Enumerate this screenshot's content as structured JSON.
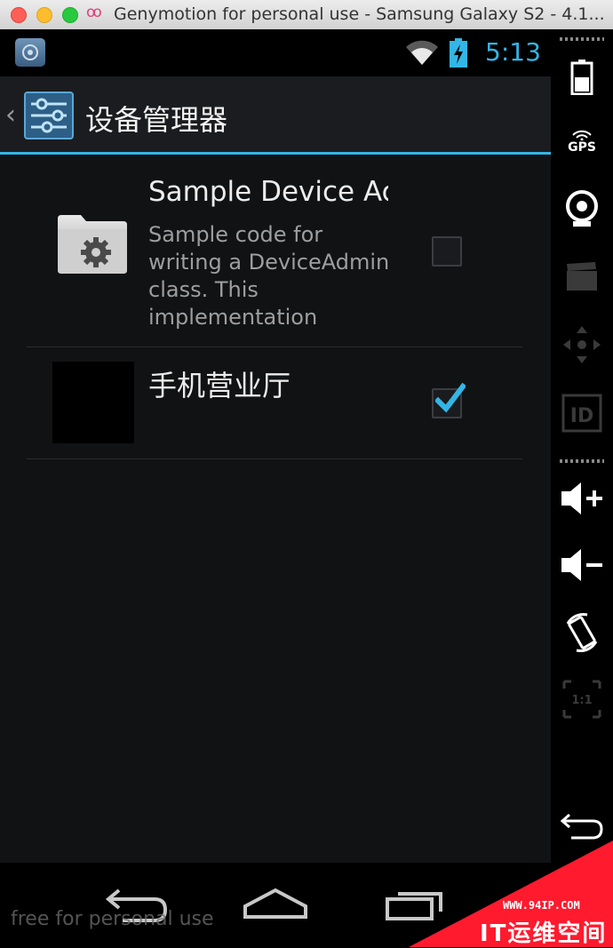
{
  "window": {
    "title": "Genymotion for personal use - Samsung Galaxy S2 - 4.1...",
    "logo": "oo"
  },
  "statusbar": {
    "time": "5:13",
    "icons": [
      "app-icon",
      "wifi-icon",
      "battery-charging-icon"
    ]
  },
  "actionbar": {
    "title": "设备管理器",
    "icon": "settings-sliders-icon"
  },
  "admins": [
    {
      "title": "Sample Device Ac",
      "description": "Sample code for writing a DeviceAdmin class. This implementation",
      "icon": "folder-gear-icon",
      "checked": false
    },
    {
      "title": "手机营业厅",
      "icon": "black-app-icon",
      "checked": true
    }
  ],
  "navbar": [
    "back-icon",
    "home-icon",
    "recent-apps-icon"
  ],
  "sidepanel": {
    "gps_label": "GPS",
    "id_label": "ID",
    "ratio_label": "1:1",
    "icons": [
      "battery-icon",
      "gps-icon",
      "camera-icon",
      "capture-icon",
      "dpad-icon",
      "id-icon",
      "volume-up-icon",
      "volume-down-icon",
      "rotate-icon",
      "pixel-ratio-icon",
      "back-icon"
    ]
  },
  "watermark": "free for personal use",
  "corner_badge": {
    "url": "WWW.94IP.COM",
    "text": "IT运维空间"
  },
  "colors": {
    "accent": "#33b5e5",
    "badge": "#ff1a2e"
  }
}
